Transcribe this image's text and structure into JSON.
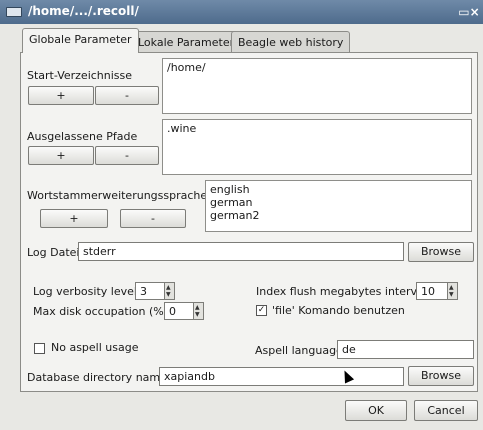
{
  "window": {
    "title": "/home/.../.recoll/",
    "maximize_glyph": "▭×"
  },
  "tabs": [
    "Globale Parameter",
    "Lokale Parameter",
    "Beagle web history"
  ],
  "start_dirs": {
    "label": "Start-Verzeichnisse",
    "items": [
      "/home/"
    ],
    "add_label": "+",
    "remove_label": "-"
  },
  "skipped_paths": {
    "label": "Ausgelassene Pfade",
    "items": [
      ".wine"
    ],
    "add_label": "+",
    "remove_label": "-"
  },
  "stem_languages": {
    "label": "Wortstammerweiterungssprachen",
    "items": [
      "english",
      "german",
      "german2"
    ],
    "add_label": "+",
    "remove_label": "-"
  },
  "log_file": {
    "label": "Log Datei",
    "value": "stderr",
    "browse_label": "Browse"
  },
  "log_verbosity": {
    "label": "Log verbosity level",
    "value": "3"
  },
  "max_disk": {
    "label": "Max disk occupation (%)",
    "value": "0"
  },
  "index_flush": {
    "label": "Index flush megabytes interval",
    "value": "10"
  },
  "file_command": {
    "label": "'file' Komando benutzen",
    "checked": true
  },
  "no_aspell": {
    "label": "No aspell usage",
    "checked": false
  },
  "aspell_language": {
    "label": "Aspell language",
    "value": "de"
  },
  "db_dir": {
    "label": "Database directory name",
    "value": "xapiandb",
    "browse_label": "Browse"
  },
  "footer": {
    "ok_label": "OK",
    "cancel_label": "Cancel"
  },
  "icons": {
    "window": "window-icon",
    "maximize": "maximize-icon",
    "spin": "spin-arrows-icon",
    "checkbox": "checkbox-icon",
    "cursor": "mouse-pointer-icon"
  }
}
